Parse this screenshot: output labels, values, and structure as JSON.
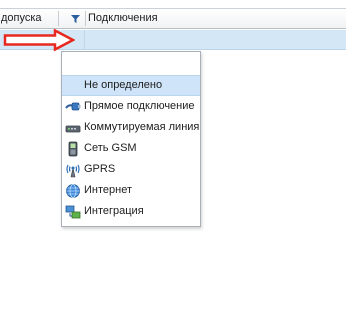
{
  "grid": {
    "columns": [
      {
        "label": "допуска"
      },
      {
        "label": "Подключения"
      }
    ]
  },
  "dropdown": {
    "items": [
      {
        "label": "",
        "icon": ""
      },
      {
        "label": "Не определено",
        "icon": "",
        "selected": true
      },
      {
        "label": "Прямое подключение",
        "icon": "ethernet-cable-icon"
      },
      {
        "label": "Коммутируемая линия",
        "icon": "modem-icon"
      },
      {
        "label": "Сеть GSM",
        "icon": "mobile-phone-icon"
      },
      {
        "label": "GPRS",
        "icon": "antenna-icon"
      },
      {
        "label": "Интернет",
        "icon": "globe-icon"
      },
      {
        "label": "Интеграция",
        "icon": "integration-icon"
      }
    ]
  },
  "colors": {
    "selection": "#cfe4f8",
    "row_highlight": "#d3e7f7",
    "arrow": "#e8281e"
  }
}
